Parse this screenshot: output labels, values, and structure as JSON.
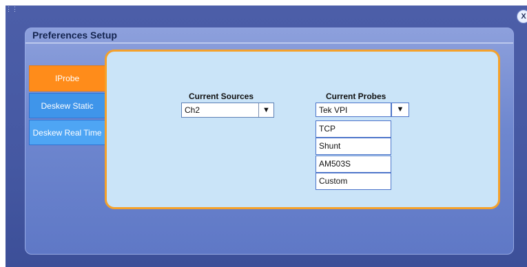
{
  "window": {
    "title": "Preferences Setup",
    "close_label": "X"
  },
  "tabs": [
    {
      "label": "IProbe",
      "state": "active"
    },
    {
      "label": "Deskew Static"
    },
    {
      "label": "Deskew Real Time"
    }
  ],
  "current_sources": {
    "label": "Current Sources",
    "selected": "Ch2",
    "arrow": "▼"
  },
  "current_probes": {
    "label": "Current Probes",
    "selected": "Tek VPI",
    "arrow": "▼",
    "options": [
      "TCP",
      "Shunt",
      "AM503S",
      "Custom"
    ]
  },
  "colors": {
    "accent_orange": "#ff8c1a",
    "tab_blue": "#3f95ea",
    "content_bg": "#cae4f8"
  }
}
